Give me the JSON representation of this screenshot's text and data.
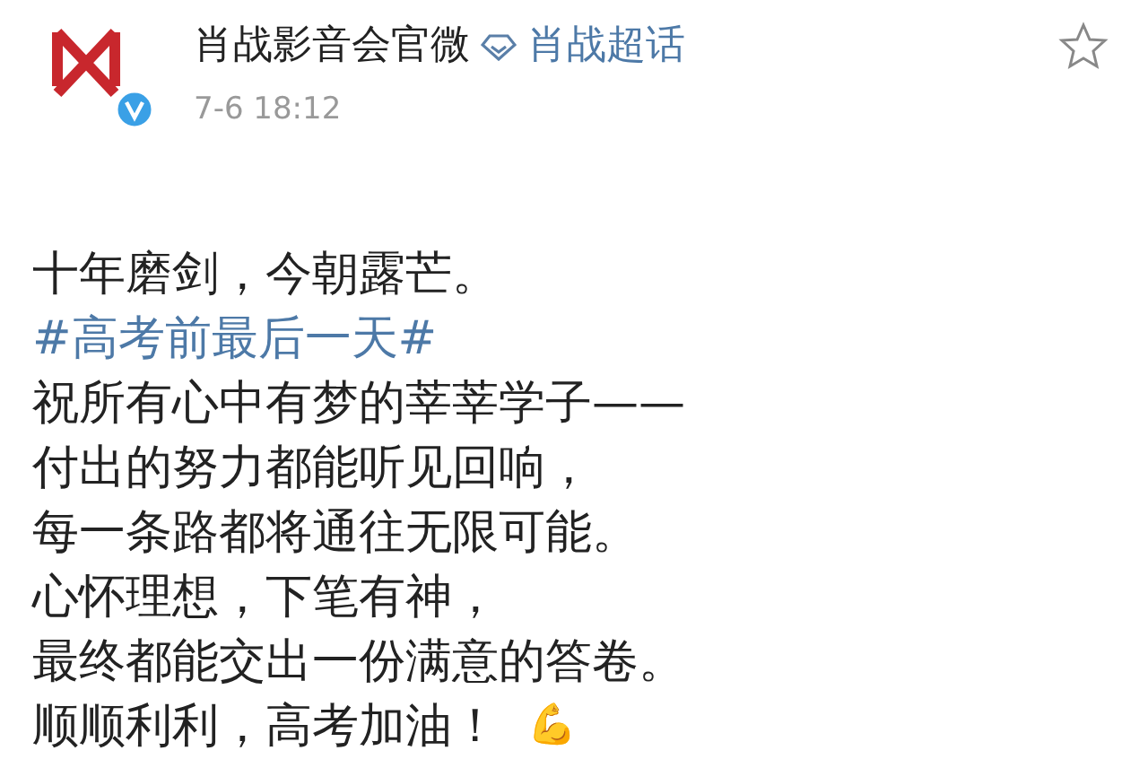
{
  "post": {
    "author": "肖战影音会官微",
    "topic": "肖战超话",
    "time": "7-6 18:12",
    "verified": true,
    "lines": [
      {
        "kind": "text",
        "text": "十年磨剑，今朝露芒。"
      },
      {
        "kind": "hashtag",
        "text": "#高考前最后一天#"
      },
      {
        "kind": "text",
        "text": "祝所有心中有梦的莘莘学子——"
      },
      {
        "kind": "text",
        "text": "付出的努力都能听见回响，"
      },
      {
        "kind": "text",
        "text": "每一条路都将通往无限可能。"
      },
      {
        "kind": "text",
        "text": "心怀理想，下笔有神，"
      },
      {
        "kind": "text",
        "text": "最终都能交出一份满意的答卷。"
      },
      {
        "kind": "text",
        "text": "顺顺利利，高考加油！",
        "emoji": "💪"
      }
    ]
  }
}
